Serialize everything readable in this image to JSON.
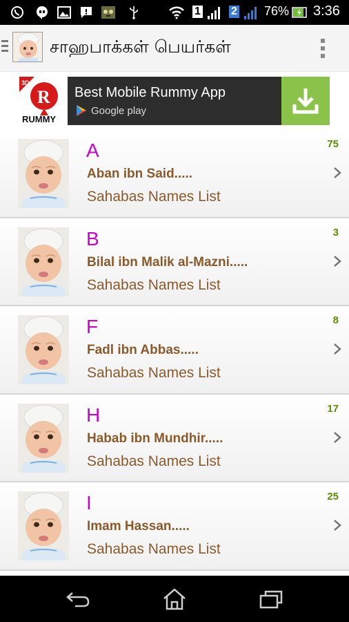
{
  "status_bar": {
    "sim1": "1",
    "sim2": "2",
    "battery": "76%",
    "time": "3:36",
    "icons": [
      "whatsapp-icon",
      "hangouts-icon",
      "gallery-icon",
      "message-icon",
      "talking-tom-icon",
      "usb-icon",
      "wifi-icon",
      "signal-icon",
      "battery-charging-icon"
    ]
  },
  "action_bar": {
    "title": "சாஹபாக்கள் பெயர்கள்",
    "icon": "baby-app-icon",
    "overflow_icon": "overflow-menu-icon"
  },
  "ad": {
    "title": "Best Mobile Rummy App",
    "store": "Google play",
    "logo_3d": "3D",
    "logo_text": "RUMMY",
    "logo_letter": "R",
    "accent": "#8bc34a"
  },
  "colors": {
    "letter": "#cc00cc",
    "name": "#8b5a2b",
    "count": "#5a8f00"
  },
  "items": [
    {
      "letter": "A",
      "name": "Aban ibn Said.....",
      "subtitle": "Sahabas Names List",
      "count": "75"
    },
    {
      "letter": "B",
      "name": "Bilal ibn Malik al-Mazni.....",
      "subtitle": "Sahabas Names List",
      "count": "3"
    },
    {
      "letter": "F",
      "name": "Fadl ibn Abbas.....",
      "subtitle": "Sahabas Names List",
      "count": "8"
    },
    {
      "letter": "H",
      "name": "Habab ibn Mundhir.....",
      "subtitle": "Sahabas Names List",
      "count": "17"
    },
    {
      "letter": "I",
      "name": "Imam Hassan.....",
      "subtitle": "Sahabas Names List",
      "count": "25"
    }
  ],
  "nav": {
    "back": "back-icon",
    "home": "home-icon",
    "recents": "recents-icon"
  }
}
